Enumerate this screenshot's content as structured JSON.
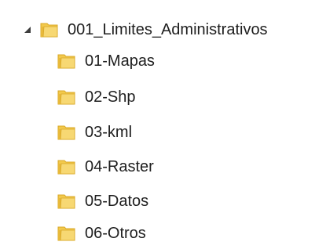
{
  "tree": {
    "root": {
      "label": "001_Limites_Administrativos",
      "expanded": true,
      "expander_icon": "expanded-triangle-icon",
      "icon": "folder-icon"
    },
    "children": [
      {
        "label": "01-Mapas",
        "icon": "folder-icon"
      },
      {
        "label": "02-Shp",
        "icon": "folder-icon"
      },
      {
        "label": "03-kml",
        "icon": "folder-icon"
      },
      {
        "label": "04-Raster",
        "icon": "folder-icon"
      },
      {
        "label": "05-Datos",
        "icon": "folder-icon"
      },
      {
        "label": "06-Otros",
        "icon": "folder-icon"
      }
    ]
  },
  "colors": {
    "folder_body": "#f2c94c",
    "folder_front": "#f7d873",
    "folder_edge": "#d9a826",
    "text": "#1e1e1e",
    "expander": "#3c3c3c"
  }
}
